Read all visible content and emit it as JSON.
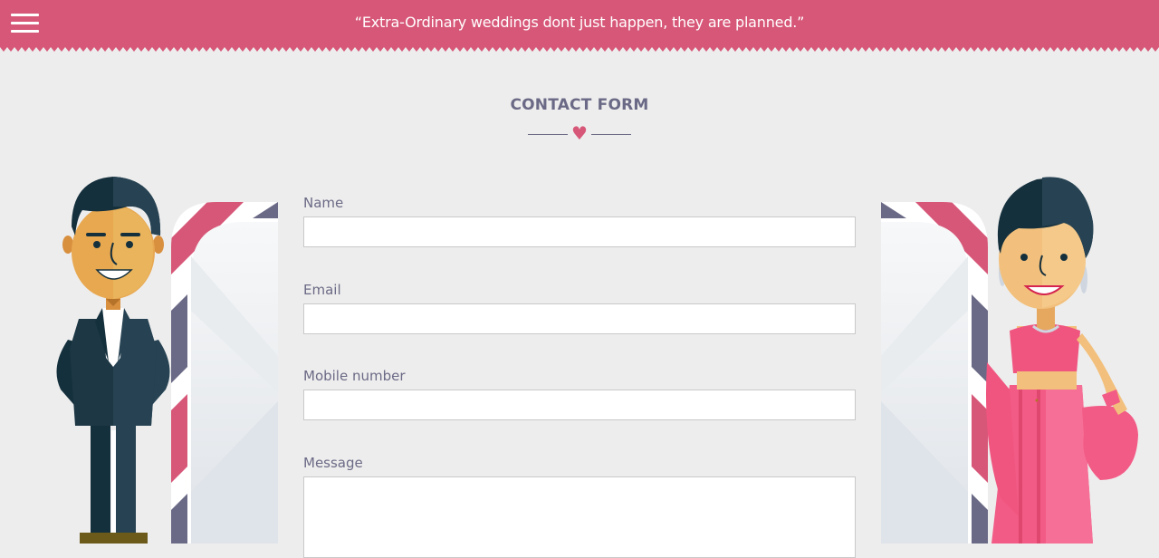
{
  "header": {
    "quote": "“Extra-Ordinary weddings dont just happen, they are planned.”",
    "menu_icon": "hamburger-menu-icon"
  },
  "title": "CONTACT FORM",
  "divider_icon": "heart-icon",
  "form": {
    "name_label": "Name",
    "name_value": "",
    "email_label": "Email",
    "email_value": "",
    "mobile_label": "Mobile number",
    "mobile_value": "",
    "message_label": "Message",
    "message_value": ""
  },
  "colors": {
    "brand_pink": "#d75778",
    "text_gray": "#6b6a86",
    "background": "#ededed"
  }
}
